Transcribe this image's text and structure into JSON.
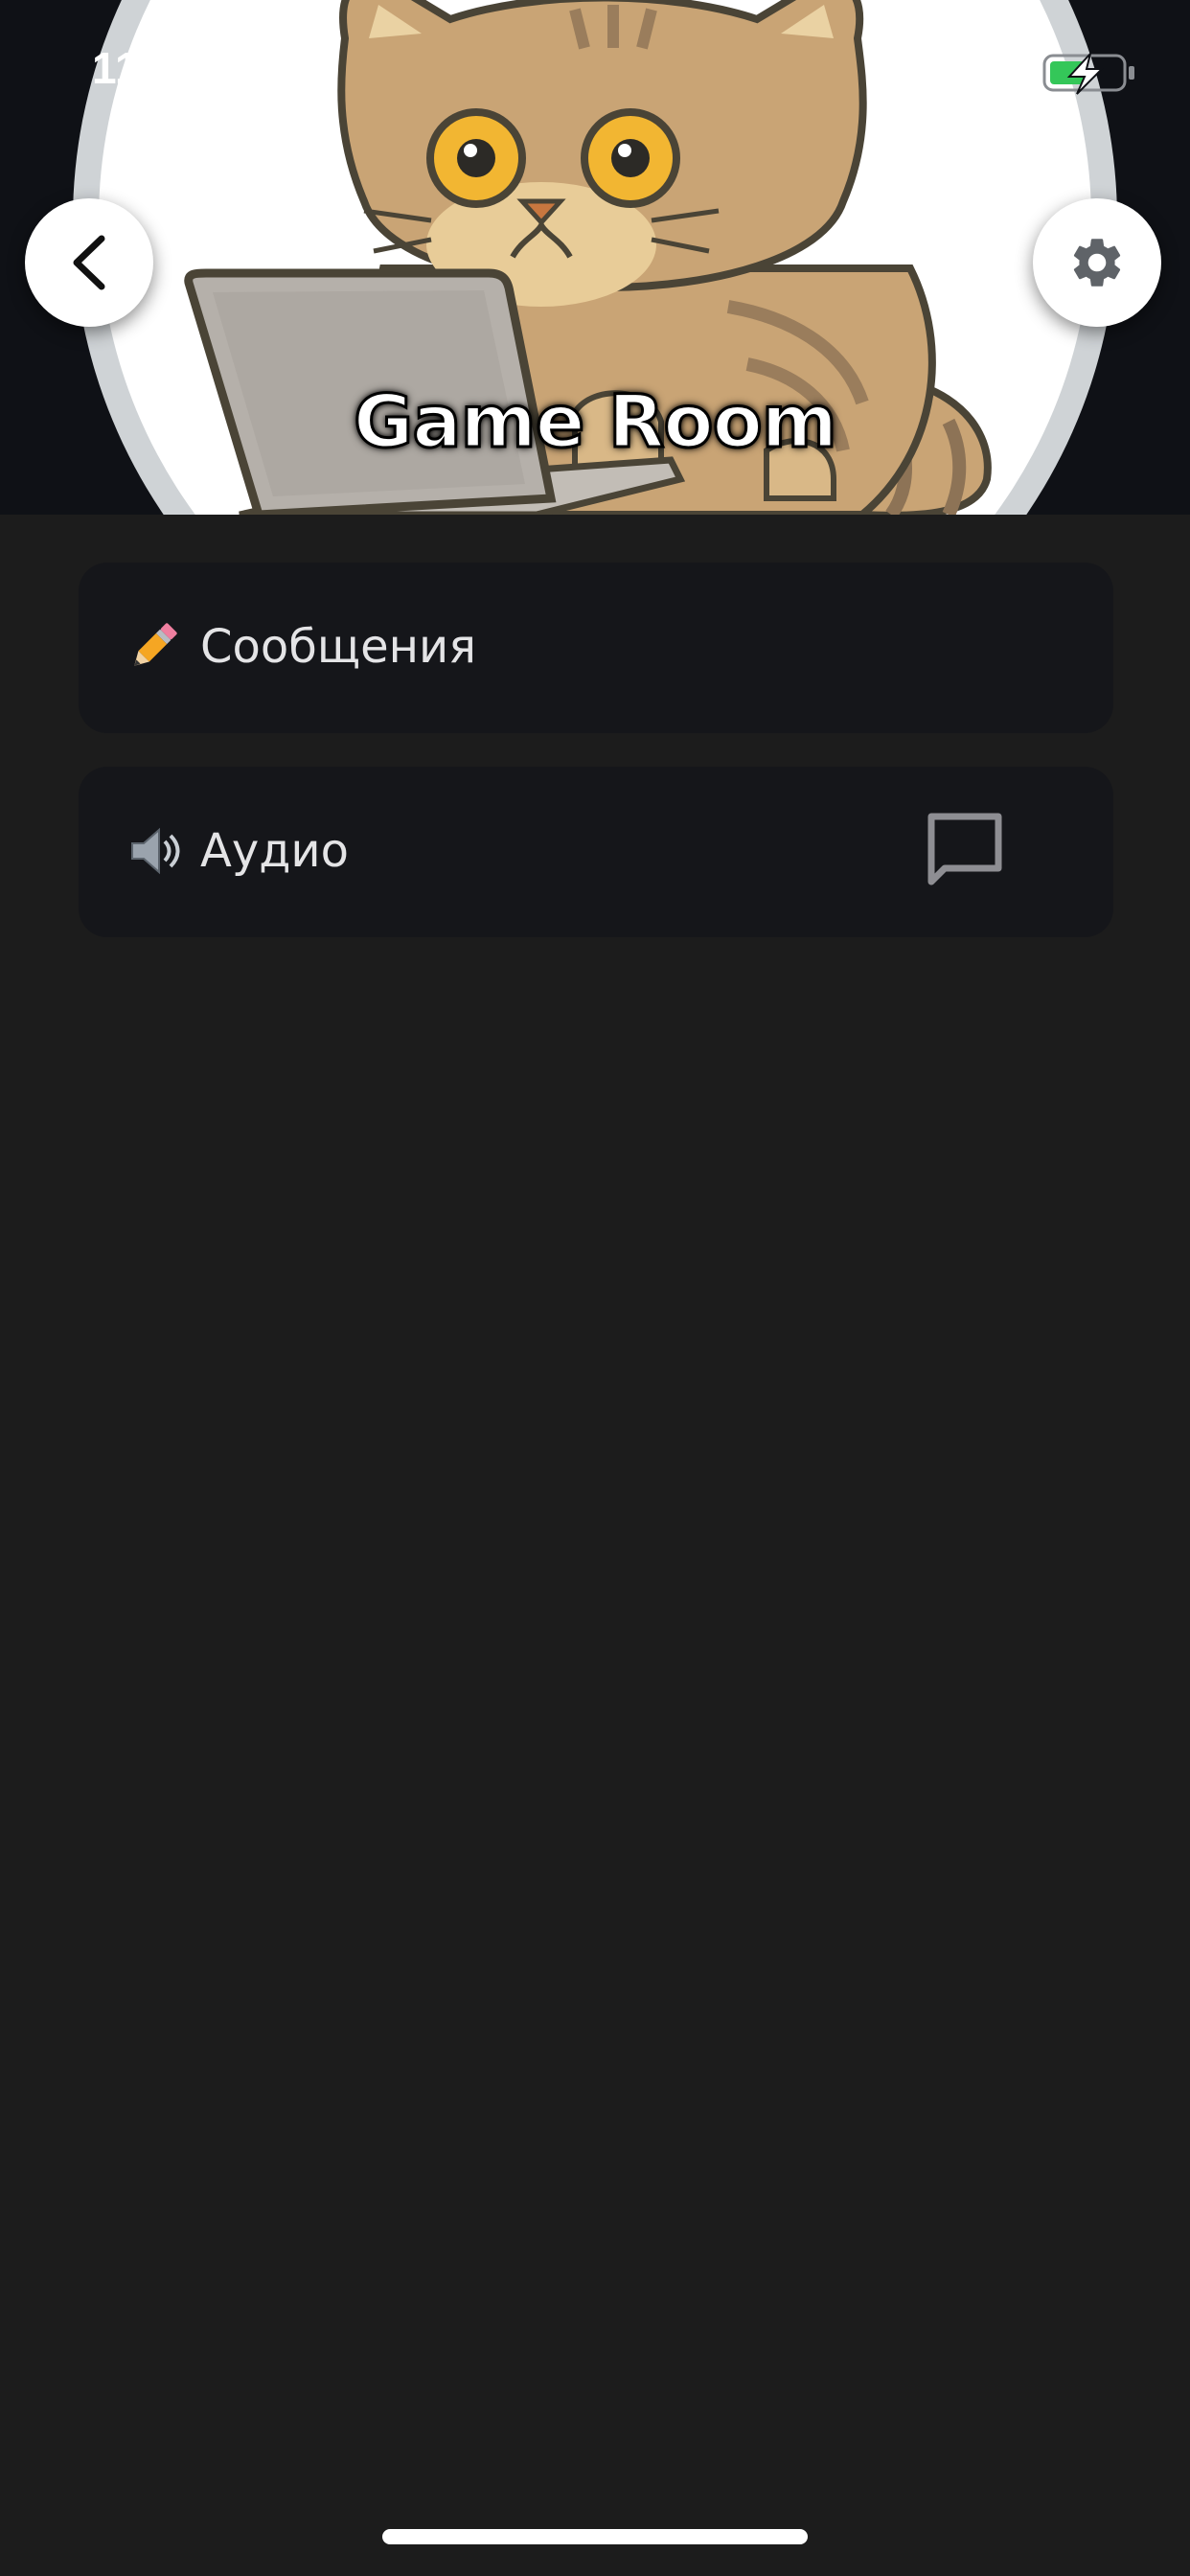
{
  "status_bar": {
    "time": "11:",
    "battery_color": "#34c759"
  },
  "header": {
    "title": "Game Room",
    "background_color": "#0f1116",
    "back_icon": "chevron-left-icon",
    "settings_icon": "gear-icon",
    "avatar_image": "cat-with-laptop-illustration"
  },
  "channels": [
    {
      "emoji": "pencil-icon",
      "label": "Сообщения"
    },
    {
      "emoji": "speaker-icon",
      "label": "Аудио",
      "action_icon": "chat-bubble-icon"
    }
  ],
  "colors": {
    "page_background": "#1c1c1c",
    "card_background": "#15161a",
    "text": "#e4e4e6"
  }
}
